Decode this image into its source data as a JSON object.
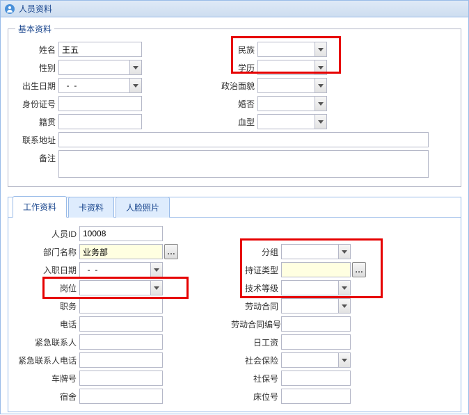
{
  "window": {
    "title": "人员资料"
  },
  "basic": {
    "legend": "基本资料",
    "labels": {
      "name": "姓名",
      "gender": "性别",
      "birth": "出生日期",
      "idno": "身份证号",
      "native": "籍贯",
      "contact_addr": "联系地址",
      "remark": "备注",
      "nation": "民族",
      "education": "学历",
      "political": "政治面貌",
      "marriage": "婚否",
      "blood": "血型"
    },
    "values": {
      "name": "王五",
      "gender": "",
      "birth": "  -  -",
      "idno": "",
      "native": "",
      "contact_addr": "",
      "remark": "",
      "nation": "",
      "education": "",
      "political": "",
      "marriage": "",
      "blood": ""
    }
  },
  "tabs": {
    "work": "工作资料",
    "card": "卡资料",
    "face": "人脸照片"
  },
  "work": {
    "labels": {
      "person_id": "人员ID",
      "dept": "部门名称",
      "hire_date": "入职日期",
      "post": "岗位",
      "duty": "职务",
      "phone": "电话",
      "emergency_contact": "紧急联系人",
      "emergency_phone": "紧急联系人电话",
      "plate": "车牌号",
      "dorm": "宿舍",
      "group": "分组",
      "cert_type": "持证类型",
      "tech_level": "技术等级",
      "contract": "劳动合同",
      "contract_no": "劳动合同编号",
      "day_wage": "日工资",
      "insurance": "社会保险",
      "ssn": "社保号",
      "bed": "床位号"
    },
    "values": {
      "person_id": "10008",
      "dept": "业务部",
      "hire_date": "  -  -",
      "post": "",
      "duty": "",
      "phone": "",
      "emergency_contact": "",
      "emergency_phone": "",
      "plate": "",
      "dorm": "",
      "group": "",
      "cert_type": "",
      "tech_level": "",
      "contract": "",
      "contract_no": "",
      "day_wage": "",
      "insurance": "",
      "ssn": "",
      "bed": ""
    }
  }
}
